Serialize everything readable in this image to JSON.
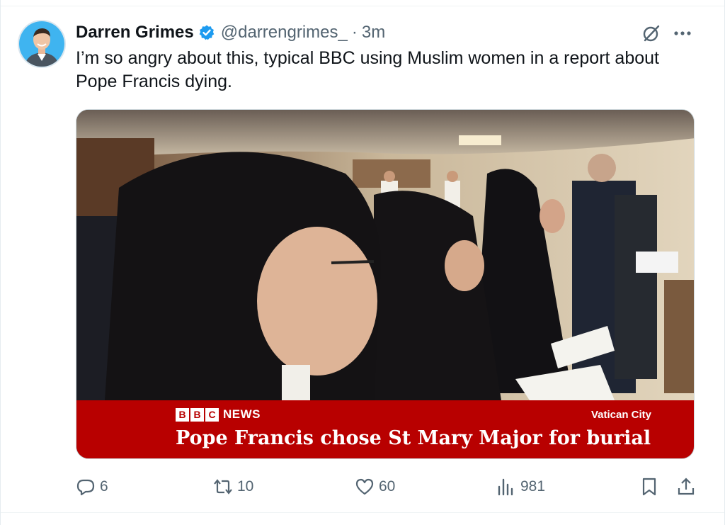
{
  "author": {
    "display_name": "Darren Grimes",
    "handle": "@darrengrimes_",
    "separator": "·",
    "time": "3m",
    "verified": true,
    "verified_color": "#1d9bf0"
  },
  "tweet": {
    "text": "I’m so angry about this, typical BBC using Muslim women in a report about Pope Francis dying."
  },
  "media": {
    "description_icon": "news-video-frame",
    "bbc_letters": [
      "B",
      "B",
      "C"
    ],
    "news_label": "NEWS",
    "location": "Vatican City",
    "headline": "Pope Francis chose St Mary Major for burial",
    "banner_color": "#b80000"
  },
  "actions": {
    "reply_count": "6",
    "repost_count": "10",
    "like_count": "60",
    "views_count": "981"
  },
  "icons": {
    "grok": "grok-icon",
    "more": "more-icon",
    "reply": "reply-icon",
    "repost": "repost-icon",
    "like": "heart-icon",
    "views": "views-icon",
    "bookmark": "bookmark-icon",
    "share": "share-icon"
  }
}
